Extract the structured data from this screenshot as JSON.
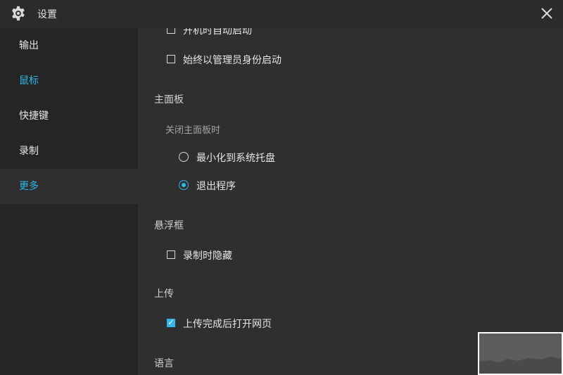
{
  "window": {
    "title": "设置"
  },
  "sidebar": {
    "items": [
      {
        "label": "输出"
      },
      {
        "label": "鼠标"
      },
      {
        "label": "快捷键"
      },
      {
        "label": "录制"
      },
      {
        "label": "更多"
      }
    ],
    "selected": "更多"
  },
  "content": {
    "startup": {
      "autostart_label": "开机时自动启动",
      "autostart_checked": false,
      "admin_label": "始终以管理员身份启动",
      "admin_checked": false
    },
    "main_panel": {
      "title": "主面板",
      "close_behavior_label": "关闭主面板时",
      "options": [
        {
          "label": "最小化到系统托盘",
          "selected": false
        },
        {
          "label": "退出程序",
          "selected": true
        }
      ]
    },
    "floating": {
      "title": "悬浮框",
      "hide_when_recording_label": "录制时隐藏",
      "hide_when_recording_checked": false
    },
    "upload": {
      "title": "上传",
      "open_after_upload_label": "上传完成后打开网页",
      "open_after_upload_checked": true
    },
    "language": {
      "title": "语言"
    }
  },
  "colors": {
    "accent": "#2fb7e8",
    "background": "#2f2f2f",
    "sidebar": "#252525",
    "titlebar": "#2b2b2b"
  },
  "icons": {
    "app": "gear-icon",
    "close": "close-icon"
  }
}
